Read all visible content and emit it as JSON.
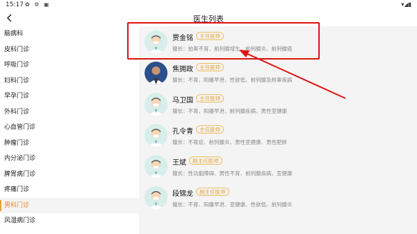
{
  "status_bar": {
    "time": "15:17",
    "left_icons": "✿ ⚙ ▣",
    "right_icons": "▾◢▮"
  },
  "nav": {
    "back_icon": "chevron-left",
    "title": "医生列表"
  },
  "departments": [
    {
      "label": "脑病科",
      "active": false
    },
    {
      "label": "皮科门诊",
      "active": false
    },
    {
      "label": "呼吸门诊",
      "active": false
    },
    {
      "label": "妇科门诊",
      "active": false
    },
    {
      "label": "早孕门诊",
      "active": false
    },
    {
      "label": "外科门诊",
      "active": false
    },
    {
      "label": "心血管门诊",
      "active": false
    },
    {
      "label": "肿瘤门诊",
      "active": false
    },
    {
      "label": "内分泌门诊",
      "active": false
    },
    {
      "label": "脾胃病门诊",
      "active": false
    },
    {
      "label": "疼痛门诊",
      "active": false
    },
    {
      "label": "男科门诊",
      "active": true
    },
    {
      "label": "风湿病门诊",
      "active": false
    }
  ],
  "doctors": [
    {
      "name": "贾金铭",
      "title": "主任医师",
      "specialty": "擅长：拍睾不育、前列腺增生、前列腺炎、前列腺癌",
      "avatar": "cartoon"
    },
    {
      "name": "焦拥政",
      "title": "主任医师",
      "specialty": "擅长：不育、阳痿早泄、性欲低、前列腺及附睾疾病",
      "avatar": "photo"
    },
    {
      "name": "马卫国",
      "title": "主任医师",
      "specialty": "擅长：不育、阳痿早泄、前列腺疾病、男性亚健康",
      "avatar": "cartoon"
    },
    {
      "name": "孔令青",
      "title": "主任医师",
      "specialty": "擅长：不育症、前列腺炎、男性亚健康、男性肥胖",
      "avatar": "cartoon"
    },
    {
      "name": "王斌",
      "title": "副主任医师",
      "specialty": "擅长：性功能障碍、男性不育、前列腺疾病、亚健康",
      "avatar": "cartoon"
    },
    {
      "name": "段锦龙",
      "title": "副主任医师",
      "specialty": "擅长：不育、阳痿早泄、亚健康、性欲低、前列腺炎",
      "avatar": "cartoon"
    }
  ],
  "colors": {
    "accent": "#e08a2a",
    "badge": "#e3a233",
    "annotation": "#e01010",
    "content_bg": "#f4f4f4"
  }
}
